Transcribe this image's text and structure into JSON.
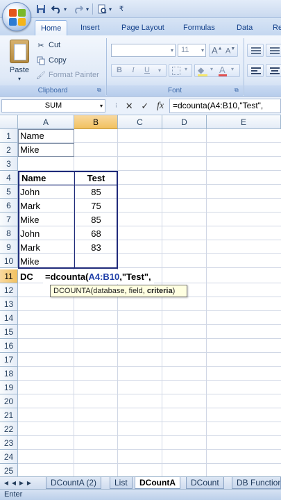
{
  "title_bar": {
    "qat_items": [
      {
        "name": "save",
        "icon": "save-icon"
      },
      {
        "name": "undo",
        "icon": "undo-icon"
      },
      {
        "name": "redo",
        "icon": "redo-icon"
      },
      {
        "name": "print-preview",
        "icon": "print-preview-icon"
      }
    ]
  },
  "ribbon": {
    "tabs": [
      "Home",
      "Insert",
      "Page Layout",
      "Formulas",
      "Data",
      "Re"
    ],
    "active_tab": "Home",
    "clipboard": {
      "paste_label": "Paste",
      "cut_label": "Cut",
      "copy_label": "Copy",
      "format_painter_label": "Format Painter",
      "group_label": "Clipboard"
    },
    "font": {
      "font_size": "11",
      "group_label": "Font",
      "bold": "B",
      "italic": "I",
      "underline": "U"
    }
  },
  "formula_bar": {
    "name_box": "SUM",
    "cancel": "✕",
    "enter": "✓",
    "fx": "fx",
    "formula": "=dcounta(A4:B10,\"Test\","
  },
  "grid": {
    "columns": [
      "A",
      "B",
      "C",
      "D",
      "E"
    ],
    "selected_column": "B",
    "rows": [
      "1",
      "2",
      "3",
      "4",
      "5",
      "6",
      "7",
      "8",
      "9",
      "10",
      "11",
      "12",
      "13",
      "14",
      "15",
      "16",
      "17",
      "18",
      "19",
      "20",
      "21",
      "22",
      "23",
      "24",
      "25"
    ],
    "selected_row": "11",
    "cells": {
      "A1": "Name",
      "A2": "Mike",
      "A4": "Name",
      "B4": "Test",
      "A5": "John",
      "B5": "85",
      "A6": "Mark",
      "B6": "75",
      "A7": "Mike",
      "B7": "85",
      "A8": "John",
      "B8": "68",
      "A9": "Mark",
      "B9": "83",
      "A10": "Mike",
      "A11": "DC"
    },
    "active_cell_edit": {
      "prefix": "=dcounta(",
      "range": "A4:B10",
      "suffix": ",\"Test\","
    },
    "tooltip": {
      "func": "DCOUNTA(database, field, ",
      "current_arg": "criteria",
      "close": ")"
    }
  },
  "sheet_tabs": [
    "DCountA (2)",
    "List",
    "DCountA",
    "DCount",
    "DB Functions"
  ],
  "active_sheet": "DCountA",
  "status_bar": {
    "mode": "Enter"
  }
}
